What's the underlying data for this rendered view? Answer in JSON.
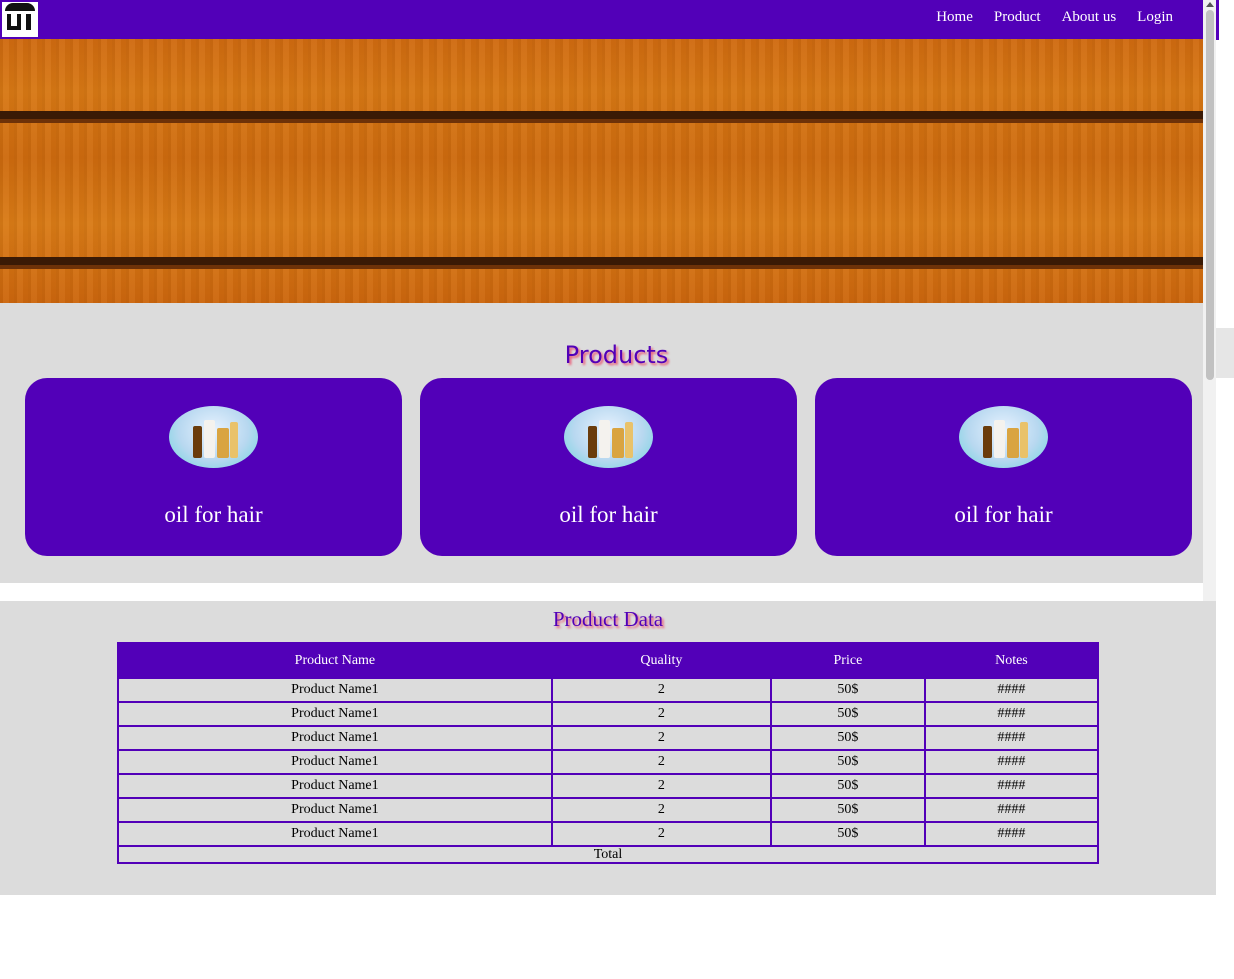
{
  "nav": {
    "links": [
      "Home",
      "Product",
      "About us",
      "Login"
    ]
  },
  "products": {
    "title": "Products",
    "cards": [
      {
        "name": "oil for hair"
      },
      {
        "name": "oil for hair"
      },
      {
        "name": "oil for hair"
      }
    ]
  },
  "product_data": {
    "title": "Product Data",
    "columns": [
      "Product Name",
      "Quality",
      "Price",
      "Notes"
    ],
    "rows": [
      [
        "Product Name1",
        "2",
        "50$",
        "####"
      ],
      [
        "Product Name1",
        "2",
        "50$",
        "####"
      ],
      [
        "Product Name1",
        "2",
        "50$",
        "####"
      ],
      [
        "Product Name1",
        "2",
        "50$",
        "####"
      ],
      [
        "Product Name1",
        "2",
        "50$",
        "####"
      ],
      [
        "Product Name1",
        "2",
        "50$",
        "####"
      ],
      [
        "Product Name1",
        "2",
        "50$",
        "####"
      ]
    ],
    "footer": "Total"
  },
  "colors": {
    "brand": "#5200b8",
    "section_bg": "#dcdcdc",
    "title_shadow": "#e8607a"
  }
}
